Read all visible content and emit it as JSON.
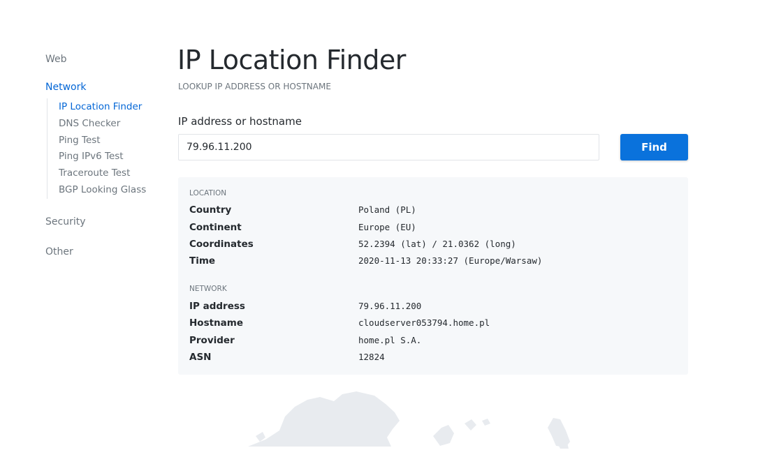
{
  "sidebar": {
    "sections": {
      "web": "Web",
      "network": "Network",
      "security": "Security",
      "other": "Other"
    },
    "network_items": [
      {
        "label": "IP Location Finder",
        "active": true
      },
      {
        "label": "DNS Checker",
        "active": false
      },
      {
        "label": "Ping Test",
        "active": false
      },
      {
        "label": "Ping IPv6 Test",
        "active": false
      },
      {
        "label": "Traceroute Test",
        "active": false
      },
      {
        "label": "BGP Looking Glass",
        "active": false
      }
    ]
  },
  "main": {
    "title": "IP Location Finder",
    "subtitle": "LOOKUP IP ADDRESS OR HOSTNAME",
    "field_label": "IP address or hostname",
    "input_value": "79.96.11.200",
    "find_label": "Find"
  },
  "results": {
    "location": {
      "heading": "LOCATION",
      "rows": [
        {
          "key": "Country",
          "value": "Poland (PL)"
        },
        {
          "key": "Continent",
          "value": "Europe (EU)"
        },
        {
          "key": "Coordinates",
          "value": "52.2394 (lat) / 21.0362 (long)"
        },
        {
          "key": "Time",
          "value": "2020-11-13 20:33:27 (Europe/Warsaw)"
        }
      ]
    },
    "network": {
      "heading": "NETWORK",
      "rows": [
        {
          "key": "IP address",
          "value": "79.96.11.200"
        },
        {
          "key": "Hostname",
          "value": "cloudserver053794.home.pl"
        },
        {
          "key": "Provider",
          "value": "home.pl S.A."
        },
        {
          "key": "ASN",
          "value": "12824"
        }
      ]
    }
  },
  "colors": {
    "accent": "#0366d6",
    "button": "#0a72dc",
    "muted": "#6c757d",
    "card_bg": "#f6f8fa",
    "map": "#e8ebef"
  }
}
